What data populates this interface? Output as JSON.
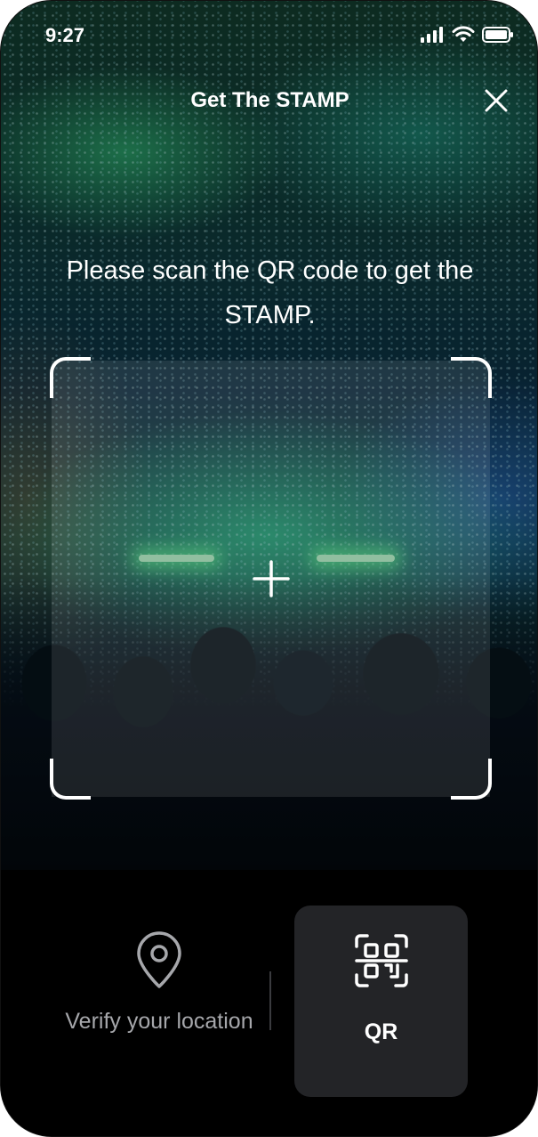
{
  "status_bar": {
    "time": "9:27",
    "icons": [
      "signal-icon",
      "wifi-icon",
      "battery-icon"
    ]
  },
  "header": {
    "title": "Get The STAMP",
    "close_icon": "close-icon"
  },
  "scanner": {
    "instruction": "Please scan the QR code to get the STAMP.",
    "frame_icon": "crosshair-icon"
  },
  "bottom_options": [
    {
      "label": "Verify your location",
      "icon": "location-pin-icon",
      "selected": false
    },
    {
      "label": "QR",
      "icon": "qr-code-icon",
      "selected": true
    }
  ],
  "colors": {
    "panel_background": "#000000",
    "selected_option_background": "#232427",
    "inactive_text": "#a6a7ab",
    "active_text": "#ffffff"
  }
}
